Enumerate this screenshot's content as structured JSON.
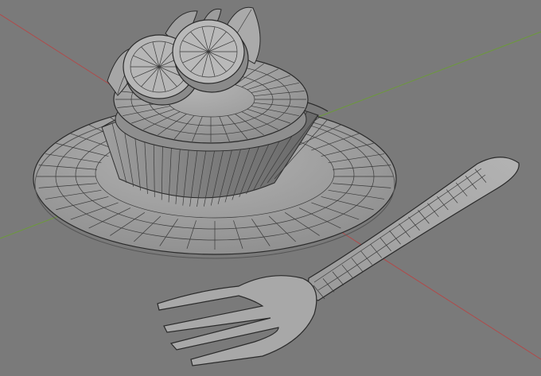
{
  "viewport": {
    "background": "#7a7a7a",
    "axis_x_color": "#b04a4a",
    "axis_y_color": "#6c9a3a",
    "mesh_fill": "#9a9a9a",
    "wire_color": "#3a3a3a"
  },
  "scene": {
    "objects": [
      "plate",
      "cupcake-liner",
      "cake-top",
      "citrus-slice-1",
      "citrus-slice-2",
      "leaf-1",
      "leaf-2",
      "leaf-3",
      "leaf-4",
      "fork"
    ]
  }
}
